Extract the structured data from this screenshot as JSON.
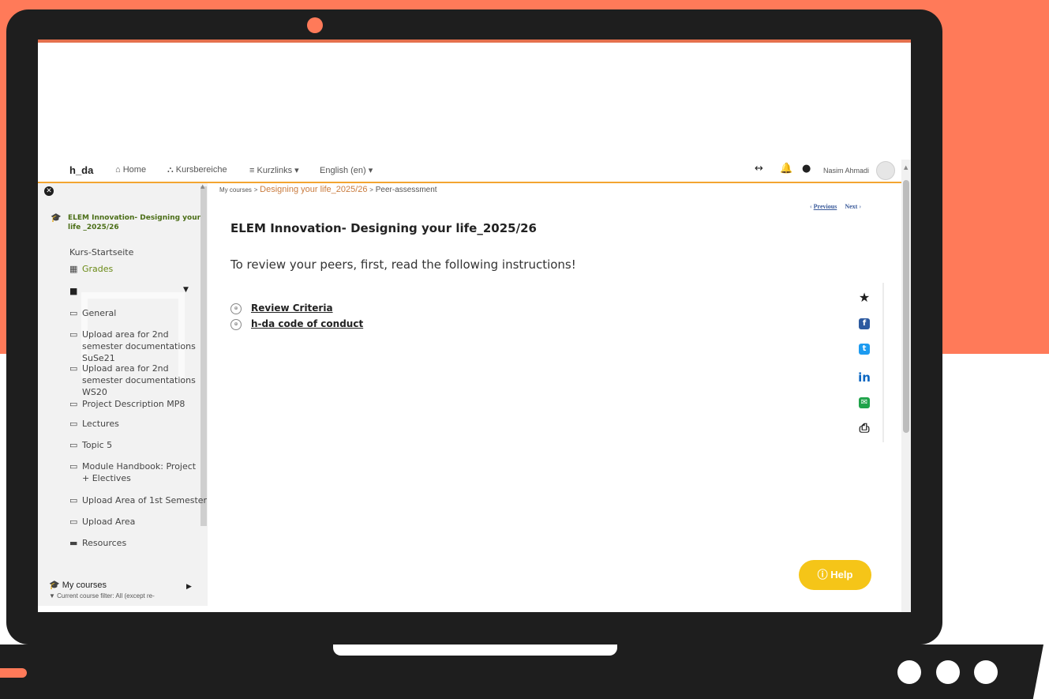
{
  "colors": {
    "accent_orange": "#ff7a59",
    "laptop": "#1e1e1e",
    "nav_underline": "#f3a531",
    "help_button": "#f5c518",
    "course_green": "#4b6e17"
  },
  "navbar": {
    "brand": "h_da",
    "home": "Home",
    "kursbereiche": "Kursbereiche",
    "kurzlinks": "Kurzlinks ▾",
    "language": "English (en) ▾",
    "username": "Nasim Ahmadi",
    "icons": [
      "home-icon",
      "sitemap-icon",
      "menu-icon",
      "expand-arrows-icon",
      "bell-icon",
      "chat-icon",
      "avatar-icon"
    ]
  },
  "drawer": {
    "course_title": "ELEM Innovation- Designing your life _2025/26",
    "start_page": "Kurs-Startseite",
    "grades": "Grades",
    "sections": [
      "General",
      "Upload area for 2nd semester documentations SuSe21",
      "Upload area for 2nd semester documentations WS20",
      "Project Description MP8",
      "Lectures",
      "Topic 5",
      "Module Handbook: Project + Electives",
      "Upload Area of 1st Semester",
      "Upload Area"
    ],
    "resources": "Resources",
    "my_courses": "My courses",
    "filter_text": "Current course filter: All (except re-"
  },
  "breadcrumb": {
    "my_courses": "My courses",
    "course": "Designing your life_2025/26",
    "current": "Peer-assessment"
  },
  "pagination": {
    "previous": "Previous",
    "next": "Next"
  },
  "main": {
    "title": "ELEM Innovation- Designing your life_2025/26",
    "intro": "To review your peers, first, read the following instructions!",
    "links": [
      "Review Criteria",
      "h-da code of conduct"
    ]
  },
  "share": [
    "star-icon",
    "facebook-icon",
    "twitter-icon",
    "linkedin-icon",
    "email-icon",
    "print-icon"
  ],
  "help": {
    "label": "Help"
  }
}
